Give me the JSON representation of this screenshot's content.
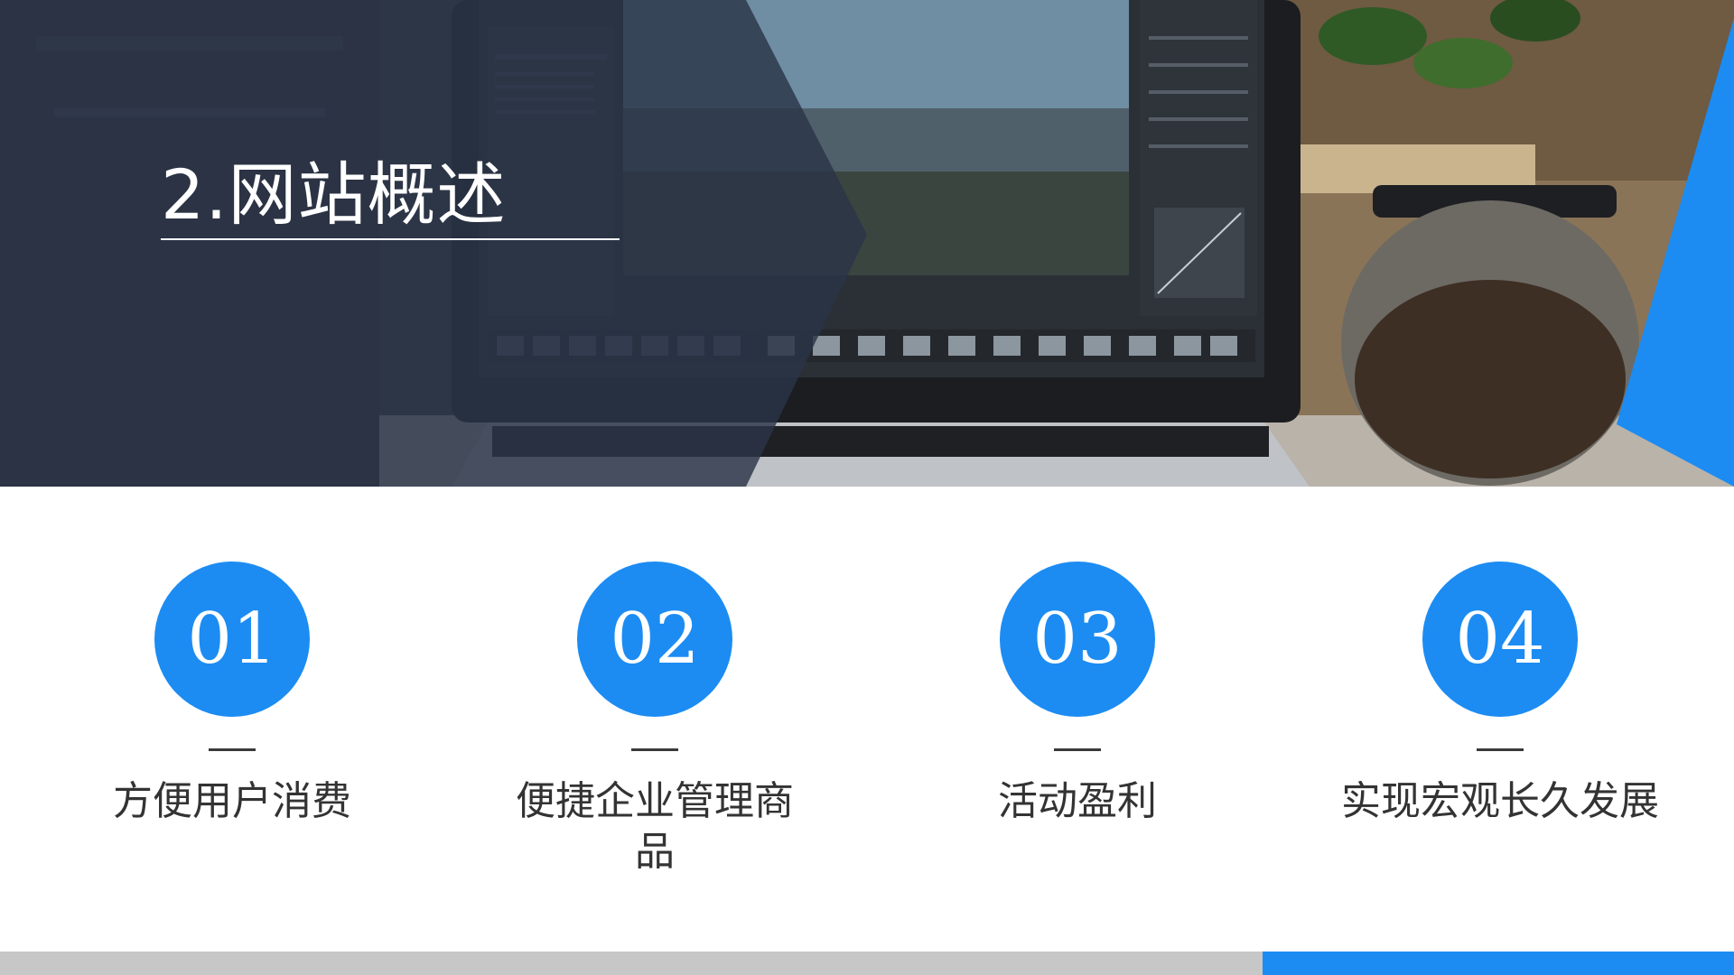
{
  "hero": {
    "title": "2.网站概述"
  },
  "features": [
    {
      "number": "01",
      "label": "方便用户消费"
    },
    {
      "number": "02",
      "label": "便捷企业管理商品"
    },
    {
      "number": "03",
      "label": "活动盈利"
    },
    {
      "number": "04",
      "label": "实现宏观长久发展"
    }
  ],
  "colors": {
    "accent_blue": "#1c8cf3",
    "footer_gray": "#c7c7c7",
    "text_dark": "#333333"
  }
}
